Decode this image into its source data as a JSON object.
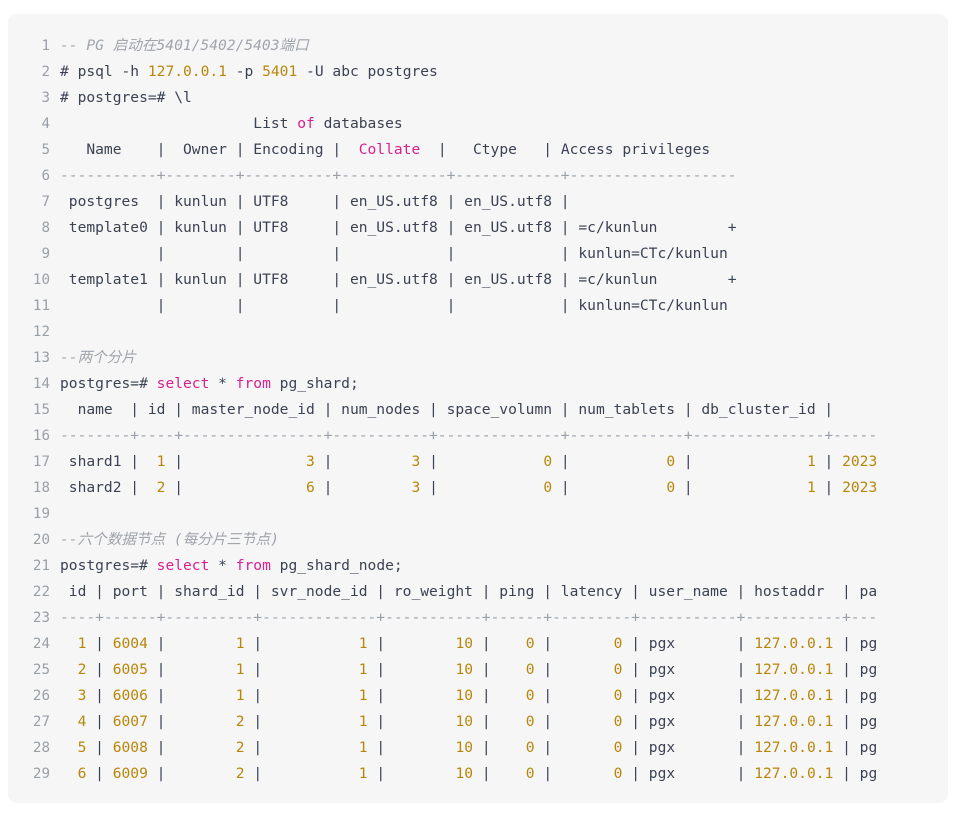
{
  "block": {
    "language": "sql",
    "background": "#f6f6f7",
    "colors": {
      "text": "#3b4252",
      "comment": "#a0a4ab",
      "keyword": "#d6218f",
      "number": "#b8860b",
      "separator": "#9aa0a8",
      "gutter": "#9aa0a8"
    }
  },
  "lines": [
    {
      "n": "1",
      "tokens": [
        {
          "t": "cmt",
          "v": "-- PG 启动在5401/5402/5403端口"
        }
      ]
    },
    {
      "n": "2",
      "tokens": [
        {
          "t": "txt",
          "v": "# psql -h "
        },
        {
          "t": "num",
          "v": "127.0.0.1"
        },
        {
          "t": "txt",
          "v": " -p "
        },
        {
          "t": "num",
          "v": "5401"
        },
        {
          "t": "txt",
          "v": " -U abc postgres"
        }
      ]
    },
    {
      "n": "3",
      "tokens": [
        {
          "t": "txt",
          "v": "# postgres=# \\l"
        }
      ]
    },
    {
      "n": "4",
      "tokens": [
        {
          "t": "txt",
          "v": "                      List "
        },
        {
          "t": "kw",
          "v": "of"
        },
        {
          "t": "txt",
          "v": " databases"
        }
      ]
    },
    {
      "n": "5",
      "tokens": [
        {
          "t": "txt",
          "v": "   Name    |  Owner | Encoding |  "
        },
        {
          "t": "kw",
          "v": "Collate"
        },
        {
          "t": "txt",
          "v": "  |   Ctype   | Access privileges"
        }
      ]
    },
    {
      "n": "6",
      "tokens": [
        {
          "t": "dash",
          "v": "-----------+--------+----------+------------+------------+-------------------"
        }
      ]
    },
    {
      "n": "7",
      "tokens": [
        {
          "t": "txt",
          "v": " postgres  | kunlun | UTF8     | en_US.utf8 | en_US.utf8 |"
        }
      ]
    },
    {
      "n": "8",
      "tokens": [
        {
          "t": "txt",
          "v": " template0 | kunlun | UTF8     | en_US.utf8 | en_US.utf8 | =c/kunlun        +"
        }
      ]
    },
    {
      "n": "9",
      "tokens": [
        {
          "t": "txt",
          "v": "           |        |          |            |            | kunlun=CTc/kunlun"
        }
      ]
    },
    {
      "n": "10",
      "tokens": [
        {
          "t": "txt",
          "v": " template1 | kunlun | UTF8     | en_US.utf8 | en_US.utf8 | =c/kunlun        +"
        }
      ]
    },
    {
      "n": "11",
      "tokens": [
        {
          "t": "txt",
          "v": "           |        |          |            |            | kunlun=CTc/kunlun"
        }
      ]
    },
    {
      "n": "12",
      "tokens": [
        {
          "t": "txt",
          "v": ""
        }
      ]
    },
    {
      "n": "13",
      "tokens": [
        {
          "t": "cmt",
          "v": "--两个分片"
        }
      ]
    },
    {
      "n": "14",
      "tokens": [
        {
          "t": "txt",
          "v": "postgres=# "
        },
        {
          "t": "kw",
          "v": "select"
        },
        {
          "t": "txt",
          "v": " * "
        },
        {
          "t": "kw",
          "v": "from"
        },
        {
          "t": "txt",
          "v": " pg_shard;"
        }
      ]
    },
    {
      "n": "15",
      "tokens": [
        {
          "t": "txt",
          "v": "  name  | id | master_node_id | num_nodes | space_volumn | num_tablets | db_cluster_id |"
        }
      ]
    },
    {
      "n": "16",
      "tokens": [
        {
          "t": "dash",
          "v": "--------+----+----------------+-----------+--------------+-------------+---------------+-----"
        }
      ]
    },
    {
      "n": "17",
      "tokens": [
        {
          "t": "txt",
          "v": " shard1 |  "
        },
        {
          "t": "num",
          "v": "1"
        },
        {
          "t": "txt",
          "v": " |              "
        },
        {
          "t": "num",
          "v": "3"
        },
        {
          "t": "txt",
          "v": " |         "
        },
        {
          "t": "num",
          "v": "3"
        },
        {
          "t": "txt",
          "v": " |            "
        },
        {
          "t": "num",
          "v": "0"
        },
        {
          "t": "txt",
          "v": " |           "
        },
        {
          "t": "num",
          "v": "0"
        },
        {
          "t": "txt",
          "v": " |             "
        },
        {
          "t": "num",
          "v": "1"
        },
        {
          "t": "txt",
          "v": " | "
        },
        {
          "t": "num",
          "v": "2023"
        }
      ]
    },
    {
      "n": "18",
      "tokens": [
        {
          "t": "txt",
          "v": " shard2 |  "
        },
        {
          "t": "num",
          "v": "2"
        },
        {
          "t": "txt",
          "v": " |              "
        },
        {
          "t": "num",
          "v": "6"
        },
        {
          "t": "txt",
          "v": " |         "
        },
        {
          "t": "num",
          "v": "3"
        },
        {
          "t": "txt",
          "v": " |            "
        },
        {
          "t": "num",
          "v": "0"
        },
        {
          "t": "txt",
          "v": " |           "
        },
        {
          "t": "num",
          "v": "0"
        },
        {
          "t": "txt",
          "v": " |             "
        },
        {
          "t": "num",
          "v": "1"
        },
        {
          "t": "txt",
          "v": " | "
        },
        {
          "t": "num",
          "v": "2023"
        }
      ]
    },
    {
      "n": "19",
      "tokens": [
        {
          "t": "txt",
          "v": ""
        }
      ]
    },
    {
      "n": "20",
      "tokens": [
        {
          "t": "cmt",
          "v": "--六个数据节点 (每分片三节点)"
        }
      ]
    },
    {
      "n": "21",
      "tokens": [
        {
          "t": "txt",
          "v": "postgres=# "
        },
        {
          "t": "kw",
          "v": "select"
        },
        {
          "t": "txt",
          "v": " * "
        },
        {
          "t": "kw",
          "v": "from"
        },
        {
          "t": "txt",
          "v": " pg_shard_node;"
        }
      ]
    },
    {
      "n": "22",
      "tokens": [
        {
          "t": "txt",
          "v": " id | port | shard_id | svr_node_id | ro_weight | ping | latency | user_name | hostaddr  | pa"
        }
      ]
    },
    {
      "n": "23",
      "tokens": [
        {
          "t": "dash",
          "v": "----+------+----------+-------------+-----------+------+---------+-----------+-----------+---"
        }
      ]
    },
    {
      "n": "24",
      "tokens": [
        {
          "t": "txt",
          "v": "  "
        },
        {
          "t": "num",
          "v": "1"
        },
        {
          "t": "txt",
          "v": " | "
        },
        {
          "t": "num",
          "v": "6004"
        },
        {
          "t": "txt",
          "v": " |        "
        },
        {
          "t": "num",
          "v": "1"
        },
        {
          "t": "txt",
          "v": " |           "
        },
        {
          "t": "num",
          "v": "1"
        },
        {
          "t": "txt",
          "v": " |        "
        },
        {
          "t": "num",
          "v": "10"
        },
        {
          "t": "txt",
          "v": " |    "
        },
        {
          "t": "num",
          "v": "0"
        },
        {
          "t": "txt",
          "v": " |       "
        },
        {
          "t": "num",
          "v": "0"
        },
        {
          "t": "txt",
          "v": " | pgx       | "
        },
        {
          "t": "num",
          "v": "127.0.0.1"
        },
        {
          "t": "txt",
          "v": " | pg"
        }
      ]
    },
    {
      "n": "25",
      "tokens": [
        {
          "t": "txt",
          "v": "  "
        },
        {
          "t": "num",
          "v": "2"
        },
        {
          "t": "txt",
          "v": " | "
        },
        {
          "t": "num",
          "v": "6005"
        },
        {
          "t": "txt",
          "v": " |        "
        },
        {
          "t": "num",
          "v": "1"
        },
        {
          "t": "txt",
          "v": " |           "
        },
        {
          "t": "num",
          "v": "1"
        },
        {
          "t": "txt",
          "v": " |        "
        },
        {
          "t": "num",
          "v": "10"
        },
        {
          "t": "txt",
          "v": " |    "
        },
        {
          "t": "num",
          "v": "0"
        },
        {
          "t": "txt",
          "v": " |       "
        },
        {
          "t": "num",
          "v": "0"
        },
        {
          "t": "txt",
          "v": " | pgx       | "
        },
        {
          "t": "num",
          "v": "127.0.0.1"
        },
        {
          "t": "txt",
          "v": " | pg"
        }
      ]
    },
    {
      "n": "26",
      "tokens": [
        {
          "t": "txt",
          "v": "  "
        },
        {
          "t": "num",
          "v": "3"
        },
        {
          "t": "txt",
          "v": " | "
        },
        {
          "t": "num",
          "v": "6006"
        },
        {
          "t": "txt",
          "v": " |        "
        },
        {
          "t": "num",
          "v": "1"
        },
        {
          "t": "txt",
          "v": " |           "
        },
        {
          "t": "num",
          "v": "1"
        },
        {
          "t": "txt",
          "v": " |        "
        },
        {
          "t": "num",
          "v": "10"
        },
        {
          "t": "txt",
          "v": " |    "
        },
        {
          "t": "num",
          "v": "0"
        },
        {
          "t": "txt",
          "v": " |       "
        },
        {
          "t": "num",
          "v": "0"
        },
        {
          "t": "txt",
          "v": " | pgx       | "
        },
        {
          "t": "num",
          "v": "127.0.0.1"
        },
        {
          "t": "txt",
          "v": " | pg"
        }
      ]
    },
    {
      "n": "27",
      "tokens": [
        {
          "t": "txt",
          "v": "  "
        },
        {
          "t": "num",
          "v": "4"
        },
        {
          "t": "txt",
          "v": " | "
        },
        {
          "t": "num",
          "v": "6007"
        },
        {
          "t": "txt",
          "v": " |        "
        },
        {
          "t": "num",
          "v": "2"
        },
        {
          "t": "txt",
          "v": " |           "
        },
        {
          "t": "num",
          "v": "1"
        },
        {
          "t": "txt",
          "v": " |        "
        },
        {
          "t": "num",
          "v": "10"
        },
        {
          "t": "txt",
          "v": " |    "
        },
        {
          "t": "num",
          "v": "0"
        },
        {
          "t": "txt",
          "v": " |       "
        },
        {
          "t": "num",
          "v": "0"
        },
        {
          "t": "txt",
          "v": " | pgx       | "
        },
        {
          "t": "num",
          "v": "127.0.0.1"
        },
        {
          "t": "txt",
          "v": " | pg"
        }
      ]
    },
    {
      "n": "28",
      "tokens": [
        {
          "t": "txt",
          "v": "  "
        },
        {
          "t": "num",
          "v": "5"
        },
        {
          "t": "txt",
          "v": " | "
        },
        {
          "t": "num",
          "v": "6008"
        },
        {
          "t": "txt",
          "v": " |        "
        },
        {
          "t": "num",
          "v": "2"
        },
        {
          "t": "txt",
          "v": " |           "
        },
        {
          "t": "num",
          "v": "1"
        },
        {
          "t": "txt",
          "v": " |        "
        },
        {
          "t": "num",
          "v": "10"
        },
        {
          "t": "txt",
          "v": " |    "
        },
        {
          "t": "num",
          "v": "0"
        },
        {
          "t": "txt",
          "v": " |       "
        },
        {
          "t": "num",
          "v": "0"
        },
        {
          "t": "txt",
          "v": " | pgx       | "
        },
        {
          "t": "num",
          "v": "127.0.0.1"
        },
        {
          "t": "txt",
          "v": " | pg"
        }
      ]
    },
    {
      "n": "29",
      "tokens": [
        {
          "t": "txt",
          "v": "  "
        },
        {
          "t": "num",
          "v": "6"
        },
        {
          "t": "txt",
          "v": " | "
        },
        {
          "t": "num",
          "v": "6009"
        },
        {
          "t": "txt",
          "v": " |        "
        },
        {
          "t": "num",
          "v": "2"
        },
        {
          "t": "txt",
          "v": " |           "
        },
        {
          "t": "num",
          "v": "1"
        },
        {
          "t": "txt",
          "v": " |        "
        },
        {
          "t": "num",
          "v": "10"
        },
        {
          "t": "txt",
          "v": " |    "
        },
        {
          "t": "num",
          "v": "0"
        },
        {
          "t": "txt",
          "v": " |       "
        },
        {
          "t": "num",
          "v": "0"
        },
        {
          "t": "txt",
          "v": " | pgx       | "
        },
        {
          "t": "num",
          "v": "127.0.0.1"
        },
        {
          "t": "txt",
          "v": " | pg"
        }
      ]
    }
  ]
}
